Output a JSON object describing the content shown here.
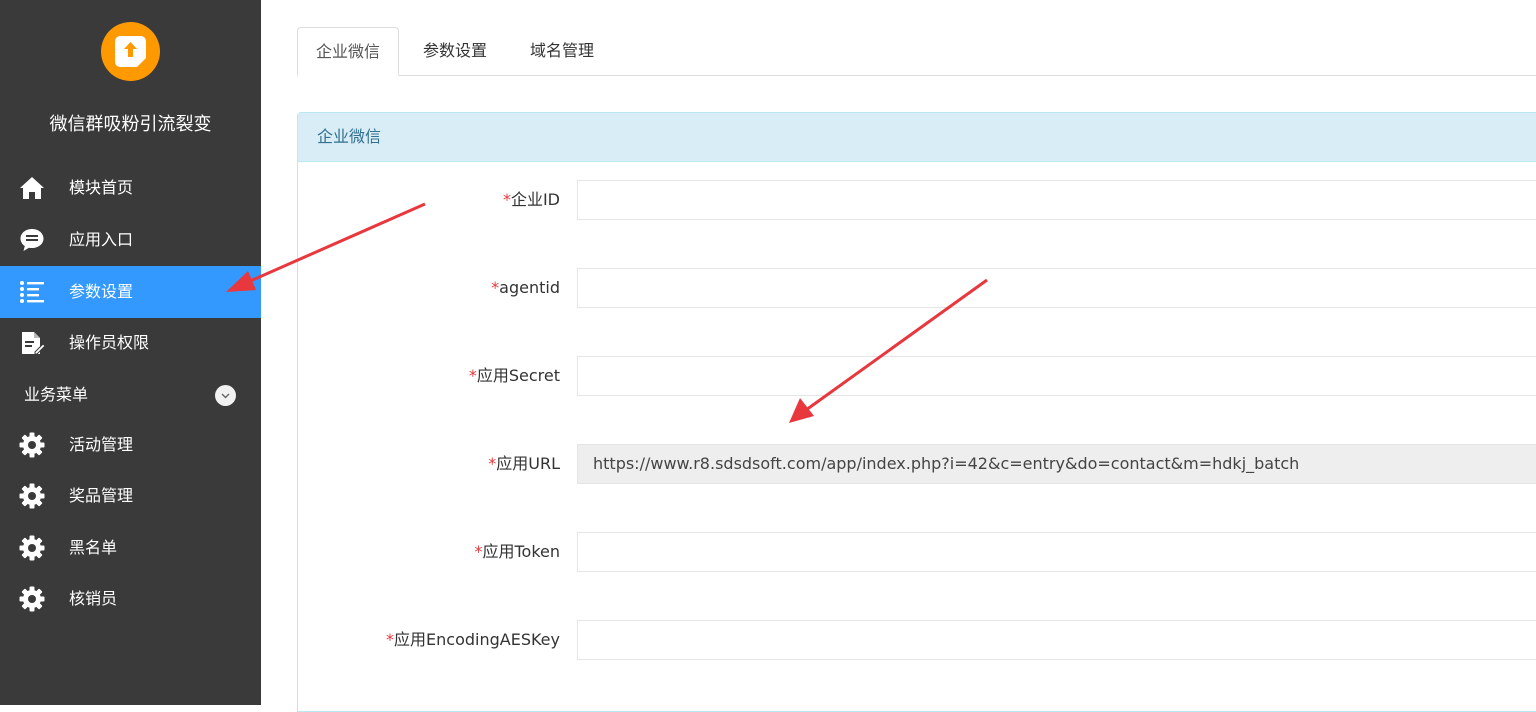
{
  "app": {
    "title": "微信群吸粉引流裂变"
  },
  "sidebar": {
    "items": [
      {
        "label": "模块首页",
        "icon": "home-icon"
      },
      {
        "label": "应用入口",
        "icon": "chat-bubble-icon"
      },
      {
        "label": "参数设置",
        "icon": "list-icon",
        "active": true
      },
      {
        "label": "操作员权限",
        "icon": "document-edit-icon"
      }
    ],
    "section": {
      "label": "业务菜单",
      "icon": "chevron-down-icon"
    },
    "business_items": [
      {
        "label": "活动管理",
        "icon": "gear-icon"
      },
      {
        "label": "奖品管理",
        "icon": "gear-icon"
      },
      {
        "label": "黑名单",
        "icon": "gear-icon"
      },
      {
        "label": "核销员",
        "icon": "gear-icon"
      }
    ]
  },
  "tabs": [
    {
      "label": "企业微信",
      "active": true
    },
    {
      "label": "参数设置"
    },
    {
      "label": "域名管理"
    }
  ],
  "panel": {
    "title": "企业微信",
    "required_mark": "*",
    "fields": [
      {
        "label": "企业ID",
        "value": ""
      },
      {
        "label": "agentid",
        "value": ""
      },
      {
        "label": "应用Secret",
        "value": ""
      },
      {
        "label": "应用URL",
        "value": "https://www.r8.sdsdsoft.com/app/index.php?i=42&c=entry&do=contact&m=hdkj_batch",
        "readonly": true
      },
      {
        "label": "应用Token",
        "value": ""
      },
      {
        "label": "应用EncodingAESKey",
        "value": ""
      }
    ]
  },
  "colors": {
    "sidebar_bg": "#3a3a3a",
    "active_blue": "#3399ff",
    "logo_orange": "#ff9900",
    "panel_heading_bg": "#d9edf7",
    "required_red": "#e8383d",
    "arrow_red": "#e8383d"
  }
}
